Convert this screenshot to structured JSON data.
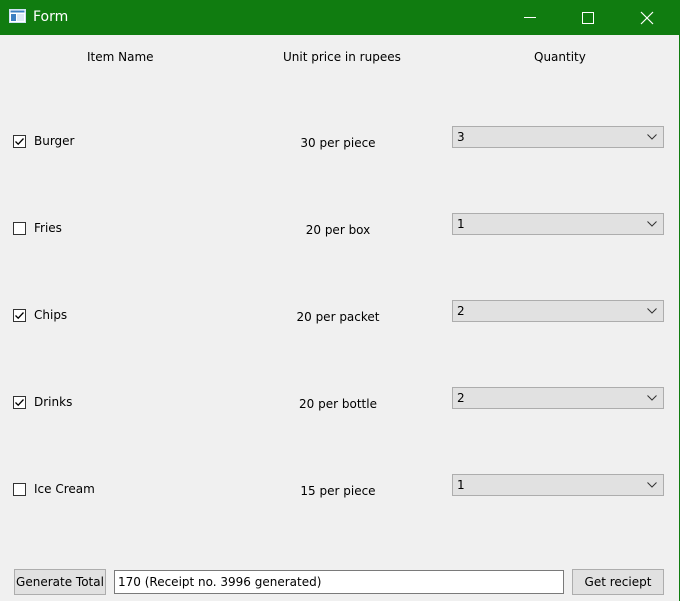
{
  "window": {
    "title": "Form",
    "titlebar_color": "#107c10"
  },
  "headers": {
    "item_name": "Item Name",
    "unit_price": "Unit price in rupees",
    "quantity": "Quantity"
  },
  "items": [
    {
      "name": "Burger",
      "price": "30 per piece",
      "checked": true,
      "quantity": "3"
    },
    {
      "name": "Fries",
      "price": "20 per box",
      "checked": false,
      "quantity": "1"
    },
    {
      "name": "Chips",
      "price": "20 per packet",
      "checked": true,
      "quantity": "2"
    },
    {
      "name": "Drinks",
      "price": "20 per bottle",
      "checked": true,
      "quantity": "2"
    },
    {
      "name": "Ice Cream",
      "price": "15 per piece",
      "checked": false,
      "quantity": "1"
    }
  ],
  "footer": {
    "generate_label": "Generate Total",
    "total_value": "170 (Receipt no. 3996 generated)",
    "receipt_label": "Get reciept"
  }
}
